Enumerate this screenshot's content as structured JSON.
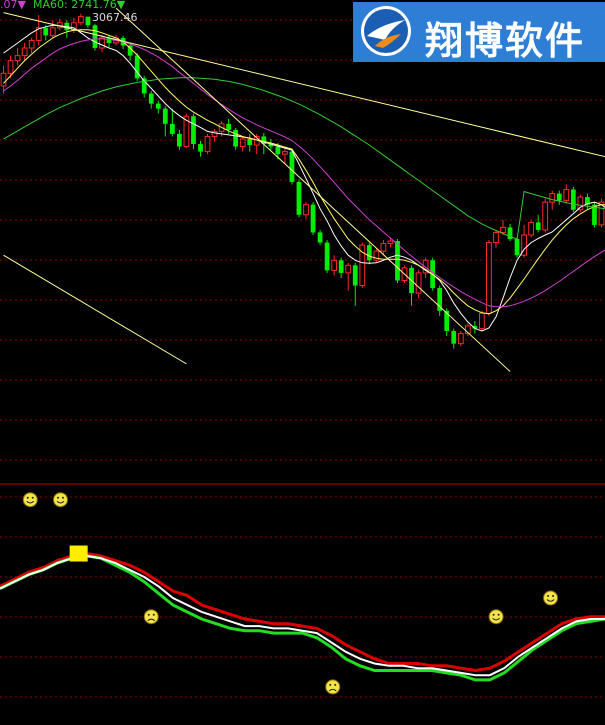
{
  "header": {
    "ma_fragment": ".07▼",
    "ma60_label": "MA60: 2741.76▼",
    "marked_price": "3067.46"
  },
  "logo": {
    "text": "翔博软件",
    "bg": "#2e7ed6"
  },
  "colors": {
    "up": "#ff2a2a",
    "down": "#00ee00",
    "ma5": "#ffffff",
    "ma10": "#ffff66",
    "ma20": "#d040d0",
    "ma60": "#33cc33",
    "trend": "#ffff99",
    "grid": "#8a0000",
    "divider": "#cc0000",
    "ind_red": "#dd0000",
    "ind_green": "#22dd22",
    "ind_white": "#ffffff",
    "marker": "#ffee00"
  },
  "chart_data": [
    {
      "type": "candlestick",
      "title": "",
      "ylim": [
        2175,
        3105
      ],
      "candles": [
        {
          "o": 2935,
          "c": 2960,
          "h": 2975,
          "l": 2920
        },
        {
          "o": 2960,
          "c": 2985,
          "h": 2995,
          "l": 2950
        },
        {
          "o": 2985,
          "c": 2995,
          "h": 3010,
          "l": 2975
        },
        {
          "o": 2995,
          "c": 3010,
          "h": 3020,
          "l": 2985
        },
        {
          "o": 3010,
          "c": 3025,
          "h": 3030,
          "l": 3000
        },
        {
          "o": 3025,
          "c": 3050,
          "h": 3075,
          "l": 3015
        },
        {
          "o": 3050,
          "c": 3035,
          "h": 3055,
          "l": 3025
        },
        {
          "o": 3035,
          "c": 3050,
          "h": 3065,
          "l": 3030
        },
        {
          "o": 3050,
          "c": 3060,
          "h": 3068,
          "l": 3045
        },
        {
          "o": 3060,
          "c": 3045,
          "h": 3065,
          "l": 3030
        },
        {
          "o": 3045,
          "c": 3060,
          "h": 3070,
          "l": 3040
        },
        {
          "o": 3060,
          "c": 3072,
          "h": 3078,
          "l": 3055
        },
        {
          "o": 3072,
          "c": 3055,
          "h": 3067,
          "l": 3050
        },
        {
          "o": 3055,
          "c": 3010,
          "h": 3058,
          "l": 3005
        },
        {
          "o": 3010,
          "c": 3030,
          "h": 3036,
          "l": 3002
        },
        {
          "o": 3030,
          "c": 3020,
          "h": 3034,
          "l": 3012
        },
        {
          "o": 3020,
          "c": 3030,
          "h": 3036,
          "l": 3015
        },
        {
          "o": 3030,
          "c": 3015,
          "h": 3034,
          "l": 3008
        },
        {
          "o": 3015,
          "c": 2995,
          "h": 3018,
          "l": 2985
        },
        {
          "o": 2995,
          "c": 2950,
          "h": 3000,
          "l": 2945
        },
        {
          "o": 2950,
          "c": 2920,
          "h": 2955,
          "l": 2912
        },
        {
          "o": 2920,
          "c": 2900,
          "h": 2925,
          "l": 2890
        },
        {
          "o": 2900,
          "c": 2890,
          "h": 2906,
          "l": 2880
        },
        {
          "o": 2890,
          "c": 2860,
          "h": 2895,
          "l": 2835
        },
        {
          "o": 2860,
          "c": 2840,
          "h": 2890,
          "l": 2835
        },
        {
          "o": 2840,
          "c": 2815,
          "h": 2848,
          "l": 2808
        },
        {
          "o": 2815,
          "c": 2875,
          "h": 2880,
          "l": 2812
        },
        {
          "o": 2875,
          "c": 2820,
          "h": 2880,
          "l": 2810
        },
        {
          "o": 2820,
          "c": 2805,
          "h": 2826,
          "l": 2795
        },
        {
          "o": 2805,
          "c": 2835,
          "h": 2840,
          "l": 2800
        },
        {
          "o": 2835,
          "c": 2845,
          "h": 2850,
          "l": 2825
        },
        {
          "o": 2845,
          "c": 2860,
          "h": 2865,
          "l": 2835
        },
        {
          "o": 2860,
          "c": 2848,
          "h": 2870,
          "l": 2840
        },
        {
          "o": 2848,
          "c": 2815,
          "h": 2852,
          "l": 2808
        },
        {
          "o": 2815,
          "c": 2830,
          "h": 2835,
          "l": 2805
        },
        {
          "o": 2830,
          "c": 2818,
          "h": 2840,
          "l": 2805
        },
        {
          "o": 2818,
          "c": 2835,
          "h": 2840,
          "l": 2800
        },
        {
          "o": 2835,
          "c": 2820,
          "h": 2842,
          "l": 2800
        },
        {
          "o": 2820,
          "c": 2815,
          "h": 2830,
          "l": 2808
        },
        {
          "o": 2815,
          "c": 2800,
          "h": 2822,
          "l": 2790
        },
        {
          "o": 2800,
          "c": 2805,
          "h": 2815,
          "l": 2780
        },
        {
          "o": 2805,
          "c": 2745,
          "h": 2810,
          "l": 2740
        },
        {
          "o": 2745,
          "c": 2680,
          "h": 2750,
          "l": 2675
        },
        {
          "o": 2680,
          "c": 2700,
          "h": 2705,
          "l": 2672
        },
        {
          "o": 2700,
          "c": 2645,
          "h": 2705,
          "l": 2640
        },
        {
          "o": 2645,
          "c": 2625,
          "h": 2650,
          "l": 2620
        },
        {
          "o": 2625,
          "c": 2570,
          "h": 2630,
          "l": 2565
        },
        {
          "o": 2570,
          "c": 2590,
          "h": 2600,
          "l": 2560
        },
        {
          "o": 2590,
          "c": 2565,
          "h": 2595,
          "l": 2555
        },
        {
          "o": 2565,
          "c": 2580,
          "h": 2585,
          "l": 2530
        },
        {
          "o": 2580,
          "c": 2540,
          "h": 2585,
          "l": 2500
        },
        {
          "o": 2540,
          "c": 2620,
          "h": 2625,
          "l": 2535
        },
        {
          "o": 2620,
          "c": 2590,
          "h": 2625,
          "l": 2582
        },
        {
          "o": 2590,
          "c": 2608,
          "h": 2614,
          "l": 2585
        },
        {
          "o": 2608,
          "c": 2623,
          "h": 2630,
          "l": 2600
        },
        {
          "o": 2623,
          "c": 2628,
          "h": 2635,
          "l": 2615
        },
        {
          "o": 2628,
          "c": 2550,
          "h": 2632,
          "l": 2545
        },
        {
          "o": 2550,
          "c": 2575,
          "h": 2580,
          "l": 2545
        },
        {
          "o": 2575,
          "c": 2525,
          "h": 2580,
          "l": 2500
        },
        {
          "o": 2525,
          "c": 2565,
          "h": 2570,
          "l": 2515
        },
        {
          "o": 2565,
          "c": 2590,
          "h": 2595,
          "l": 2555
        },
        {
          "o": 2590,
          "c": 2535,
          "h": 2595,
          "l": 2530
        },
        {
          "o": 2535,
          "c": 2490,
          "h": 2540,
          "l": 2480
        },
        {
          "o": 2490,
          "c": 2450,
          "h": 2495,
          "l": 2440
        },
        {
          "o": 2450,
          "c": 2425,
          "h": 2455,
          "l": 2415
        },
        {
          "o": 2425,
          "c": 2445,
          "h": 2450,
          "l": 2420
        },
        {
          "o": 2445,
          "c": 2460,
          "h": 2465,
          "l": 2440
        },
        {
          "o": 2460,
          "c": 2455,
          "h": 2470,
          "l": 2445
        },
        {
          "o": 2455,
          "c": 2485,
          "h": 2490,
          "l": 2450
        },
        {
          "o": 2485,
          "c": 2625,
          "h": 2630,
          "l": 2480
        },
        {
          "o": 2625,
          "c": 2645,
          "h": 2650,
          "l": 2615
        },
        {
          "o": 2645,
          "c": 2655,
          "h": 2670,
          "l": 2640
        },
        {
          "o": 2655,
          "c": 2632,
          "h": 2662,
          "l": 2628
        },
        {
          "o": 2632,
          "c": 2600,
          "h": 2636,
          "l": 2595
        },
        {
          "o": 2600,
          "c": 2640,
          "h": 2660,
          "l": 2595
        },
        {
          "o": 2640,
          "c": 2665,
          "h": 2670,
          "l": 2635
        },
        {
          "o": 2665,
          "c": 2650,
          "h": 2680,
          "l": 2645
        },
        {
          "o": 2650,
          "c": 2705,
          "h": 2712,
          "l": 2645
        },
        {
          "o": 2705,
          "c": 2722,
          "h": 2728,
          "l": 2690
        },
        {
          "o": 2722,
          "c": 2708,
          "h": 2728,
          "l": 2700
        },
        {
          "o": 2708,
          "c": 2730,
          "h": 2740,
          "l": 2702
        },
        {
          "o": 2730,
          "c": 2690,
          "h": 2735,
          "l": 2685
        },
        {
          "o": 2690,
          "c": 2715,
          "h": 2720,
          "l": 2685
        },
        {
          "o": 2715,
          "c": 2700,
          "h": 2722,
          "l": 2690
        },
        {
          "o": 2700,
          "c": 2660,
          "h": 2705,
          "l": 2655
        },
        {
          "o": 2660,
          "c": 2705,
          "h": 2712,
          "l": 2655
        }
      ],
      "ma": [
        {
          "name": "MA5",
          "color": "#ffffff",
          "y": [
            3000,
            3010,
            3020,
            3030,
            3040,
            3048,
            3052,
            3055,
            3054,
            3052,
            3050,
            3040,
            3030,
            3022,
            3016,
            3010,
            3005,
            2995,
            2980,
            2962,
            2945,
            2930,
            2915,
            2900,
            2887,
            2876,
            2867,
            2860,
            2853,
            2845,
            2842,
            2840,
            2838,
            2836,
            2834,
            2832,
            2828,
            2824,
            2820,
            2816,
            2812,
            2808,
            2780,
            2752,
            2722,
            2692,
            2668,
            2640,
            2618,
            2600,
            2590,
            2585,
            2584,
            2585,
            2590,
            2596,
            2600,
            2596,
            2590,
            2580,
            2570,
            2562,
            2550,
            2530,
            2505,
            2485,
            2468,
            2455,
            2450,
            2456,
            2478,
            2515,
            2555,
            2590,
            2612,
            2625,
            2633,
            2640,
            2646,
            2658,
            2670,
            2682,
            2695,
            2702,
            2705,
            2700,
            2690,
            2684
          ]
        },
        {
          "name": "MA10",
          "color": "#ffff66",
          "y": [
            2940,
            2955,
            2970,
            2985,
            2998,
            3010,
            3020,
            3030,
            3037,
            3042,
            3045,
            3046,
            3046,
            3044,
            3040,
            3035,
            3030,
            3022,
            3010,
            2996,
            2980,
            2964,
            2948,
            2932,
            2918,
            2905,
            2893,
            2883,
            2875,
            2867,
            2860,
            2853,
            2846,
            2840,
            2835,
            2831,
            2828,
            2825,
            2822,
            2818,
            2814,
            2810,
            2790,
            2768,
            2744,
            2718,
            2695,
            2672,
            2652,
            2632,
            2618,
            2606,
            2598,
            2594,
            2592,
            2592,
            2592,
            2590,
            2586,
            2580,
            2572,
            2562,
            2552,
            2540,
            2525,
            2512,
            2500,
            2492,
            2486,
            2484,
            2490,
            2500,
            2515,
            2534,
            2553,
            2573,
            2593,
            2612,
            2630,
            2646,
            2660,
            2672,
            2682,
            2690,
            2696,
            2700,
            2700,
            2700
          ]
        },
        {
          "name": "MA20",
          "color": "#d040d0",
          "y": [
            2925,
            2935,
            2946,
            2958,
            2970,
            2980,
            2990,
            3000,
            3008,
            3014,
            3019,
            3023,
            3026,
            3028,
            3028,
            3027,
            3025,
            3022,
            3018,
            3013,
            3007,
            3000,
            2992,
            2983,
            2973,
            2962,
            2951,
            2940,
            2929,
            2918,
            2908,
            2898,
            2889,
            2880,
            2872,
            2865,
            2858,
            2852,
            2846,
            2840,
            2834,
            2827,
            2816,
            2804,
            2790,
            2775,
            2760,
            2744,
            2728,
            2712,
            2698,
            2684,
            2670,
            2658,
            2646,
            2634,
            2622,
            2610,
            2598,
            2587,
            2576,
            2566,
            2556,
            2546,
            2537,
            2528,
            2520,
            2513,
            2506,
            2500,
            2498,
            2498,
            2500,
            2504,
            2509,
            2515,
            2522,
            2530,
            2539,
            2548,
            2558,
            2568,
            2578,
            2588,
            2597,
            2606,
            2615,
            2624
          ]
        },
        {
          "name": "MA60",
          "color": "#33cc33",
          "y": [
            2830,
            2838,
            2846,
            2854,
            2862,
            2870,
            2878,
            2885,
            2892,
            2898,
            2904,
            2910,
            2915,
            2920,
            2925,
            2929,
            2933,
            2936,
            2939,
            2942,
            2944,
            2946,
            2948,
            2949,
            2950,
            2951,
            2951,
            2951,
            2950,
            2949,
            2948,
            2946,
            2944,
            2941,
            2938,
            2934,
            2930,
            2926,
            2921,
            2916,
            2911,
            2905,
            2899,
            2892,
            2885,
            2878,
            2870,
            2862,
            2854,
            2845,
            2836,
            2827,
            2818,
            2808,
            2798,
            2788,
            2778,
            2768,
            2758,
            2748,
            2738,
            2728,
            2718,
            2708,
            2698,
            2688,
            2678,
            2670,
            2662,
            2655,
            2649,
            2643,
            2637,
            2632,
            2726,
            2722,
            2718,
            2714,
            2710,
            2707,
            2704,
            2701,
            2699,
            2697,
            2695,
            2693,
            2691,
            2690
          ]
        }
      ],
      "trend_lines": [
        {
          "x1": 0,
          "y1": 3080,
          "x2": 87,
          "y2": 2790
        },
        {
          "x1": 16,
          "y1": 3089,
          "x2": 72,
          "y2": 2370
        },
        {
          "x1": 0,
          "y1": 2600,
          "x2": 26,
          "y2": 2385
        }
      ]
    },
    {
      "type": "line",
      "title": "",
      "ylim": [
        0,
        100
      ],
      "series": [
        {
          "color": "#dd0000",
          "values": [
            58,
            61,
            64,
            66,
            69,
            71,
            72,
            71,
            69,
            67,
            64,
            60,
            56,
            54,
            50,
            48,
            46,
            44,
            43,
            42,
            42,
            41,
            40,
            37,
            33,
            30,
            27,
            25,
            25,
            25,
            24,
            24,
            23,
            22,
            23,
            26,
            30,
            34,
            38,
            42,
            44,
            45,
            45
          ]
        },
        {
          "color": "#22dd22",
          "values": [
            57,
            60,
            63,
            65,
            68,
            70,
            71,
            70,
            67,
            64,
            60,
            55,
            50,
            47,
            44,
            42,
            40,
            39,
            39,
            38,
            38,
            38,
            36,
            32,
            27,
            24,
            22,
            22,
            22,
            22,
            22,
            21,
            20,
            18,
            18,
            21,
            26,
            31,
            35,
            39,
            42,
            43,
            44
          ]
        },
        {
          "color": "#ffffff",
          "values": [
            57,
            60,
            63,
            65,
            68,
            70,
            71,
            70,
            68,
            65,
            62,
            58,
            53,
            50,
            47,
            45,
            43,
            41,
            41,
            40,
            40,
            39,
            38,
            34,
            30,
            27,
            25,
            24,
            24,
            23,
            23,
            22,
            21,
            20,
            20,
            23,
            28,
            32,
            36,
            40,
            43,
            44,
            44
          ]
        }
      ],
      "markers": [
        {
          "type": "square",
          "x": 13,
          "y": 72
        },
        {
          "type": "happy",
          "x": 5,
          "y": 95
        },
        {
          "type": "happy",
          "x": 10,
          "y": 95
        },
        {
          "type": "sad",
          "x": 25,
          "y": 45
        },
        {
          "type": "sad",
          "x": 55,
          "y": 15
        },
        {
          "type": "happy",
          "x": 82,
          "y": 45
        },
        {
          "type": "happy",
          "x": 91,
          "y": 53
        }
      ]
    }
  ]
}
